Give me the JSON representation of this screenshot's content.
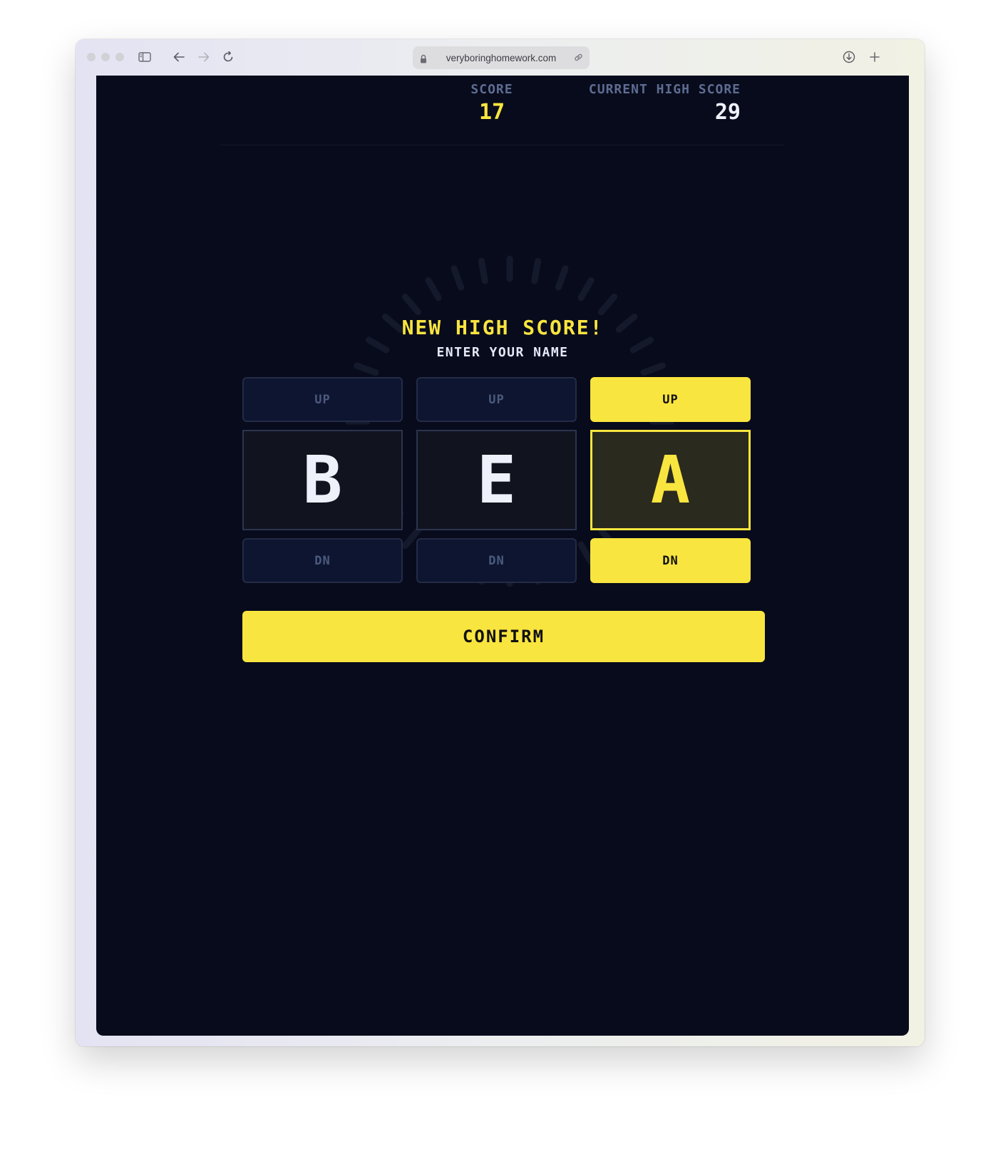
{
  "browser": {
    "url": "veryboringhomework.com"
  },
  "scoreboard": {
    "score_label": "SCORE",
    "score_value": "17",
    "high_label": "CURRENT HIGH SCORE",
    "high_value": "29"
  },
  "dialog": {
    "title": "NEW HIGH SCORE!",
    "subtitle": "ENTER YOUR NAME",
    "slots": [
      {
        "up_label": "UP",
        "letter": "B",
        "down_label": "DN",
        "active": false
      },
      {
        "up_label": "UP",
        "letter": "E",
        "down_label": "DN",
        "active": false
      },
      {
        "up_label": "UP",
        "letter": "A",
        "down_label": "DN",
        "active": true
      }
    ],
    "confirm_label": "CONFIRM"
  },
  "colors": {
    "background": "#080b1b",
    "accent_yellow": "#f9e53f",
    "muted_text": "#5d6c92",
    "letter_text": "#eef0fa"
  },
  "icons": [
    "sidebar-icon",
    "back-arrow-icon",
    "forward-arrow-icon",
    "reload-icon",
    "lock-icon",
    "link-icon",
    "download-icon",
    "new-tab-icon"
  ]
}
